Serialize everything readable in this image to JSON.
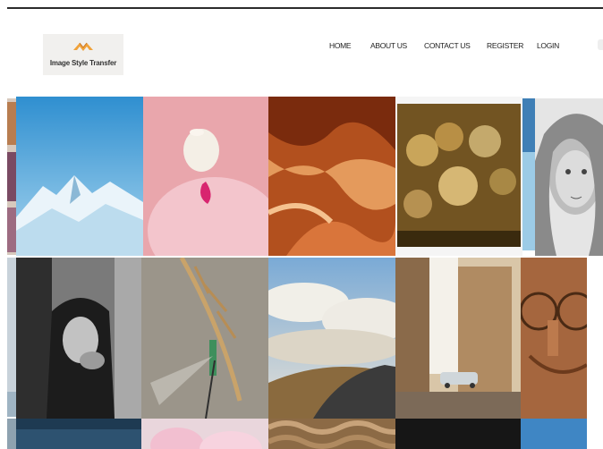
{
  "header": {
    "logo_text": "Image Style Transfer",
    "nav": [
      "HOME",
      "ABOUT US",
      "CONTACT US",
      "REGISTER",
      "LOGIN"
    ]
  },
  "colors": {
    "logo_orange": "#f0a23a",
    "nav_text": "#222222"
  },
  "gallery": {
    "tiles": [
      "icy-mountains",
      "pink-flamingo",
      "orange-canyon",
      "painted-movie-poster",
      "pencil-sketch-portrait",
      "bw-child-portrait",
      "dragonfly-on-stem",
      "clouds-and-road",
      "city-street-car",
      "old-man-glasses",
      "dark-blue-water",
      "pink-flower",
      "rope-texture",
      "dark-tile",
      "blue-tile"
    ]
  }
}
